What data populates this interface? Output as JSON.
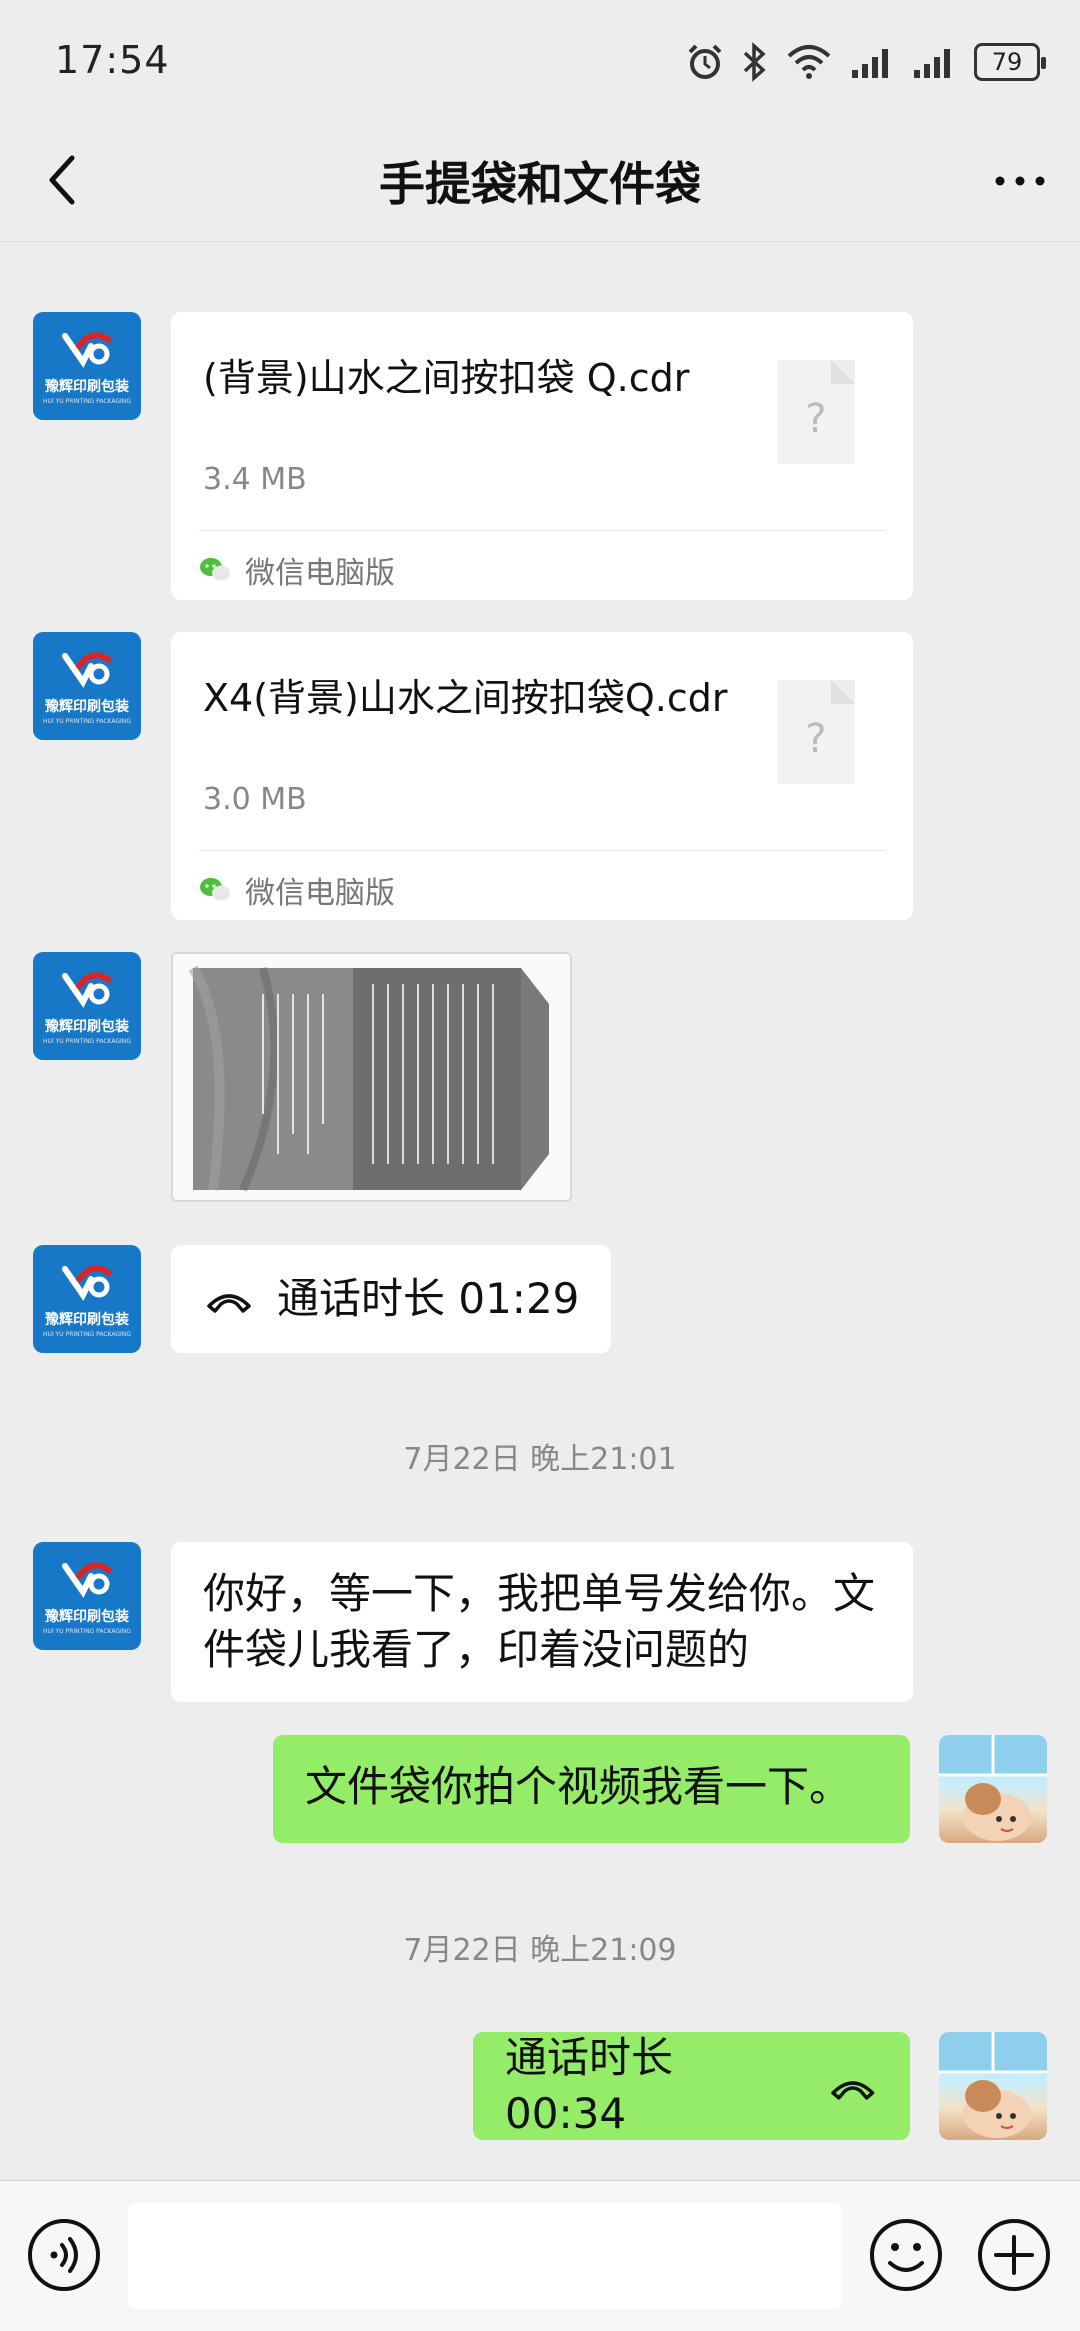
{
  "status_bar": {
    "time": "17:54",
    "battery": "79"
  },
  "header": {
    "title": "手提袋和文件袋"
  },
  "avatars": {
    "contact_logo_text": "豫辉印刷包装",
    "contact_logo_sub": "HUI YU PRINTING PACKAGING"
  },
  "messages": {
    "file1": {
      "name": "(背景)山水之间按扣袋 Q.cdr",
      "size": "3.4 MB",
      "source": "微信电脑版",
      "icon": "question-mark"
    },
    "file2": {
      "name": "X4(背景)山水之间按扣袋Q.cdr",
      "size": "3.0 MB",
      "source": "微信电脑版",
      "icon": "question-mark"
    },
    "image1": {
      "description_icon": "calligraphy-envelope-photo"
    },
    "call1": {
      "text": "通话时长 01:29"
    },
    "time1": "7月22日 晚上21:01",
    "text1": "你好，等一下，我把单号发给你。文件袋儿我看了，印着没问题的",
    "text2": "文件袋你拍个视频我看一下。",
    "time2": "7月22日 晚上21:09",
    "call2": {
      "text": "通话时长 00:34"
    }
  },
  "colors": {
    "background": "#ededed",
    "green_bubble": "#95ec69",
    "white_bubble": "#ffffff",
    "logo_blue": "#1878c8",
    "logo_red": "#d9252a"
  }
}
